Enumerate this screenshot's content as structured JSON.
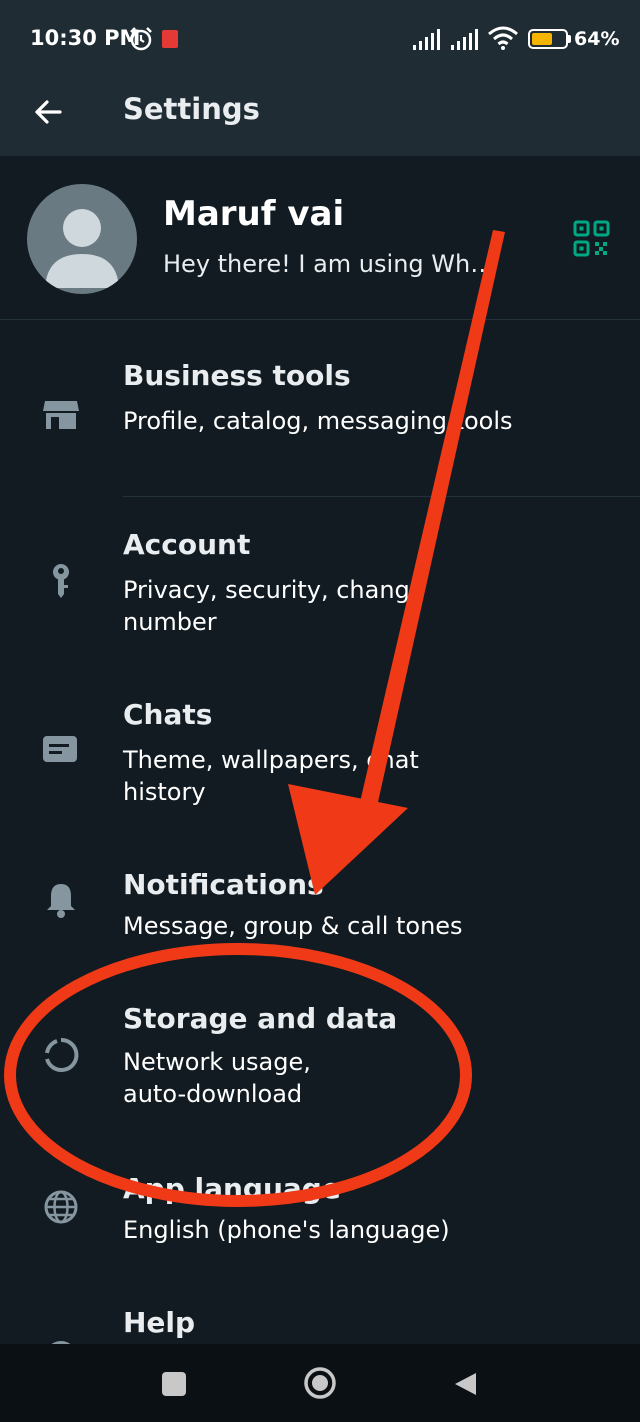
{
  "status_bar": {
    "time": "10:30 PM",
    "battery": "64%",
    "battery_level": 0.64
  },
  "app_bar": {
    "title": "Settings"
  },
  "profile": {
    "name": "Maruf vai",
    "status": "Hey there! I am using WhatsApp."
  },
  "items": [
    {
      "title": "Business tools",
      "subtitle": "Profile, catalog, messaging tools",
      "icon": "store-icon"
    },
    {
      "title": "Account",
      "subtitle": "Privacy, security, change number",
      "icon": "key-icon"
    },
    {
      "title": "Chats",
      "subtitle": "Theme, wallpapers, chat history",
      "icon": "chat-icon"
    },
    {
      "title": "Notifications",
      "subtitle": "Message, group & call tones",
      "icon": "bell-icon"
    },
    {
      "title": "Storage and data",
      "subtitle": "Network usage, auto-download",
      "icon": "storage-icon"
    },
    {
      "title": "App language",
      "subtitle": "English (phone's language)",
      "icon": "globe-icon"
    },
    {
      "title": "Help",
      "subtitle": "",
      "icon": "help-icon"
    }
  ],
  "colors": {
    "background": "#111b21",
    "bar": "#1f2c34",
    "accent": "#00a884",
    "annotation": "#f03a17"
  }
}
